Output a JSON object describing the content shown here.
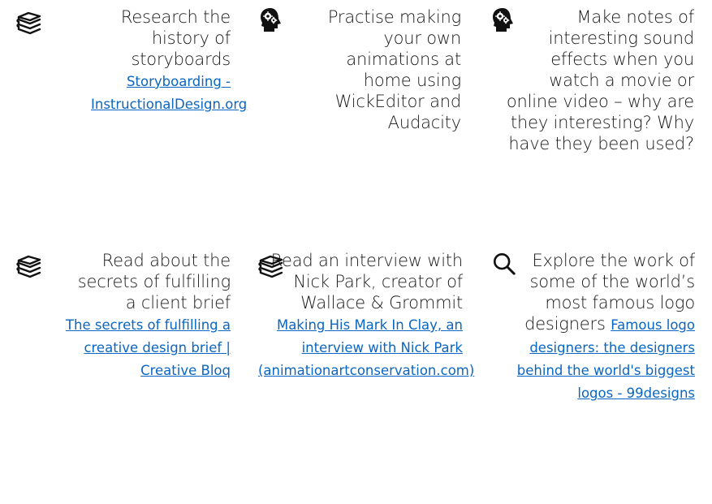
{
  "cards": [
    {
      "icon": "books-icon",
      "text": "Research the history of storyboards",
      "link": "Storyboarding - InstructionalDesign.org"
    },
    {
      "icon": "head-gears-icon",
      "text": "Practise making your own animations at home using WickEditor and Audacity",
      "link": ""
    },
    {
      "icon": "head-gears-icon",
      "text": "Make notes of interesting sound effects when you watch a movie or online video – why are they interesting? Why have they been used?",
      "link": ""
    },
    {
      "icon": "books-icon",
      "text": "Read about the secrets of fulfilling a client brief",
      "link": "The secrets of fulfilling a creative design brief | Creative Bloq"
    },
    {
      "icon": "books-icon",
      "text": "Read an interview with Nick Park, creator of Wallace & Grommit",
      "link": "Making His Mark In Clay, an interview with Nick Park (animationartconservation.com)"
    },
    {
      "icon": "search-icon",
      "text": "Explore the work of some of the world’s most famous logo designers",
      "link": "Famous logo designers: the designers behind the world's biggest logos - 99designs"
    }
  ]
}
